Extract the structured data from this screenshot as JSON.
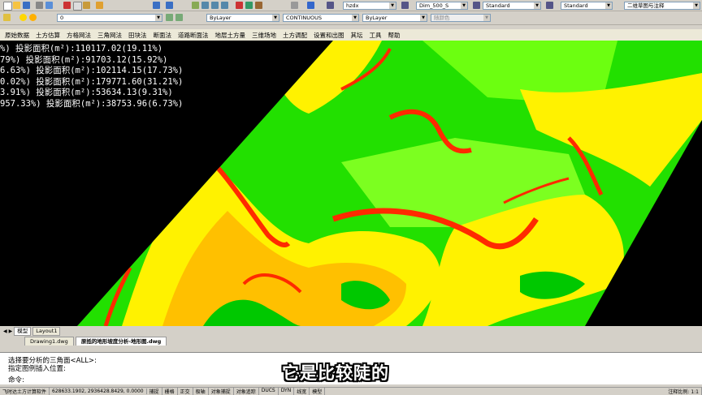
{
  "toolbar": {
    "layer_select": "0",
    "color_select": "ByLayer",
    "linetype_select": "CONTINUOUS",
    "lineweight_select": "ByLayer",
    "plotstyle_select": "随颜色",
    "text_style": "hzdx",
    "dim_style": "Dim_500_S",
    "table_style": "Standard",
    "multileader_style": "Standard",
    "workspace_select": "二维草图与注释"
  },
  "menu": [
    "原始数据",
    "土方估算",
    "方格网法",
    "三角网法",
    "田块法",
    "断面法",
    "道路断面法",
    "地层土方量",
    "三维场地",
    "土方调配",
    "设置和出图",
    "其坛",
    "工具",
    "帮助"
  ],
  "readout": [
    "%) 投影面积(m²):110117.02(19.11%)",
    "79%) 投影面积(m²):91703.12(15.92%)",
    "6.63%) 投影面积(m²):102114.15(17.73%)",
    "0.02%) 投影面积(m²):179771.60(31.21%)",
    "3.91%) 投影面积(m²):53634.13(9.31%)",
    "957.33%) 投影面积(m²):38753.96(6.73%)"
  ],
  "layout_tabs": [
    "模型",
    "Layout1"
  ],
  "doc_tabs": [
    "Drawing1.dwg",
    "原抵的地形坡度分析-地形图.dwg"
  ],
  "command": {
    "line1": "选择要分析的三角面<ALL>:",
    "line2": "指定图例插入位置:",
    "prompt": "命令:"
  },
  "subtitle": "它是比较陡的",
  "status": {
    "app": "飞时达土方计算软件",
    "coords": "628633.1902, 2936428.8429, 0.0000",
    "toggles": [
      "捕捉",
      "栅格",
      "正交",
      "极轴",
      "对象捕捉",
      "对象追踪",
      "DUCS",
      "DYN",
      "线宽",
      "模型"
    ],
    "scale": "注释比例: 1:1"
  },
  "colors": {
    "red": "#ff2a00",
    "yellow": "#fff200",
    "light_green": "#6cff00",
    "green": "#00e400",
    "dark_green": "#00b800"
  }
}
